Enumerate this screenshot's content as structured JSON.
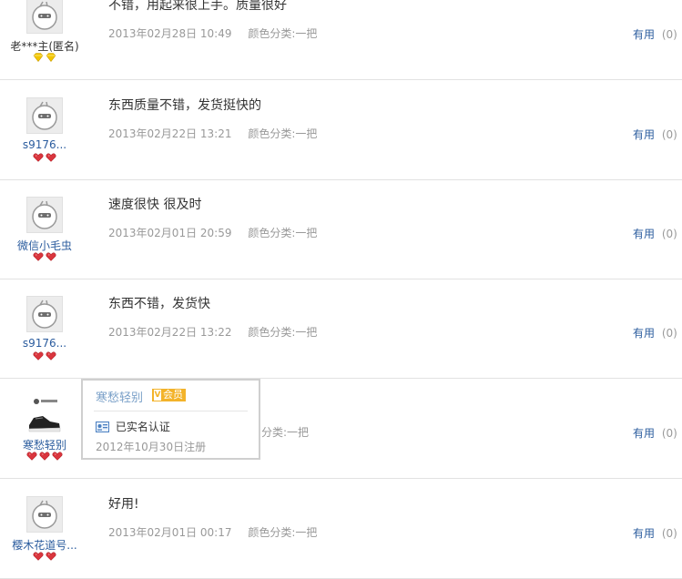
{
  "reviews": [
    {
      "user_name": "老***主(匿名)",
      "badge": "gold-diamond",
      "badge_count": 2,
      "content": "不错，用起来很上手。质量很好",
      "date": "2013年02月28日 10:49",
      "sku": "颜色分类:一把",
      "useful_label": "有用",
      "useful_count": "(0)"
    },
    {
      "user_name": "s9176...",
      "badge": "red-heart",
      "badge_count": 2,
      "content": "东西质量不错，发货挺快的",
      "date": "2013年02月22日 13:21",
      "sku": "颜色分类:一把",
      "useful_label": "有用",
      "useful_count": "(0)"
    },
    {
      "user_name": "微信小毛虫",
      "badge": "red-heart",
      "badge_count": 2,
      "content": "速度很快 很及时",
      "date": "2013年02月01日 20:59",
      "sku": "颜色分类:一把",
      "useful_label": "有用",
      "useful_count": "(0)"
    },
    {
      "user_name": "s9176...",
      "badge": "red-heart",
      "badge_count": 2,
      "content": "东西不错，发货快",
      "date": "2013年02月22日 13:22",
      "sku": "颜色分类:一把",
      "useful_label": "有用",
      "useful_count": "(0)"
    },
    {
      "user_name": "寒愁轻别",
      "badge": "red-heart",
      "badge_count": 3,
      "content": "",
      "date": "",
      "sku": "分类:一把",
      "useful_label": "有用",
      "useful_count": "(0)"
    },
    {
      "user_name": "樱木花道号...",
      "badge": "red-heart",
      "badge_count": 2,
      "content": "好用!",
      "date": "2013年02月01日 00:17",
      "sku": "颜色分类:一把",
      "useful_label": "有用",
      "useful_count": "(0)"
    }
  ],
  "popup": {
    "name": "寒愁轻别",
    "member_badge": "会员",
    "member_badge_icon": "V",
    "verified": "已实名认证",
    "registered": "2012年10月30日注册"
  },
  "colors": {
    "link": "#2b5c9e",
    "muted": "#999999",
    "divider": "#e2e2e2",
    "badge_red": "#d9363e",
    "badge_gold": "#f2c500",
    "vip": "#f3b32a"
  }
}
